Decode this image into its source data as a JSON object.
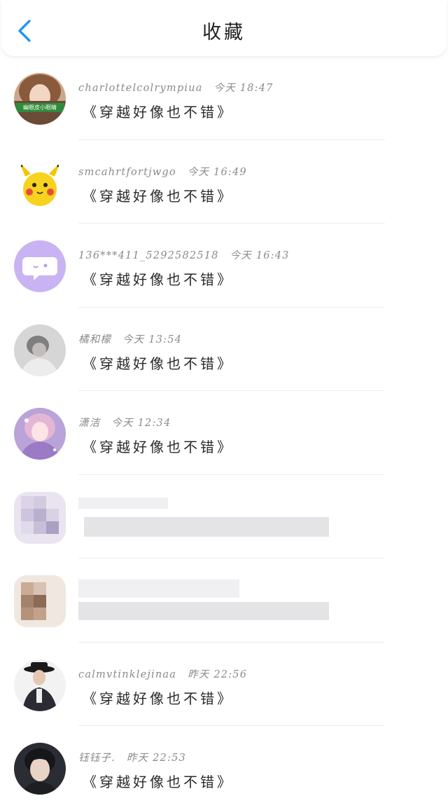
{
  "header": {
    "title": "收藏",
    "back_icon": "chevron-left-icon",
    "accent_color": "#2196F3"
  },
  "avatar_badge_text": "幽眼皮小眼睛",
  "items": [
    {
      "name": "charlottelcolrympiua",
      "time": "今天 18:47",
      "content": "《穿越好像也不错》",
      "avatar": "photo-girl"
    },
    {
      "name": "smcahrtfortjwgo",
      "time": "今天 16:49",
      "content": "《穿越好像也不错》",
      "avatar": "pikachu"
    },
    {
      "name": "136***411_5292582518",
      "time": "今天 16:43",
      "content": "《穿越好像也不错》",
      "avatar": "chat-bubble"
    },
    {
      "name": "橘和檬",
      "time": "今天 13:54",
      "content": "《穿越好像也不错》",
      "avatar": "photo-hood"
    },
    {
      "name": "潇洁",
      "time": "今天 12:34",
      "content": "《穿越好像也不错》",
      "avatar": "photo-pink"
    },
    {
      "name": "",
      "time": "",
      "content": "",
      "avatar": "pixelated",
      "blurred": true
    },
    {
      "name": "",
      "time": "",
      "content": "",
      "avatar": "pixelated",
      "blurred": true
    },
    {
      "name": "calmvtinklejinaa",
      "time": "昨天 22:56",
      "content": "《穿越好像也不错》",
      "avatar": "photo-man-hat"
    },
    {
      "name": "钰钰子.",
      "time": "昨天 22:53",
      "content": "《穿越好像也不错》",
      "avatar": "photo-man"
    }
  ]
}
